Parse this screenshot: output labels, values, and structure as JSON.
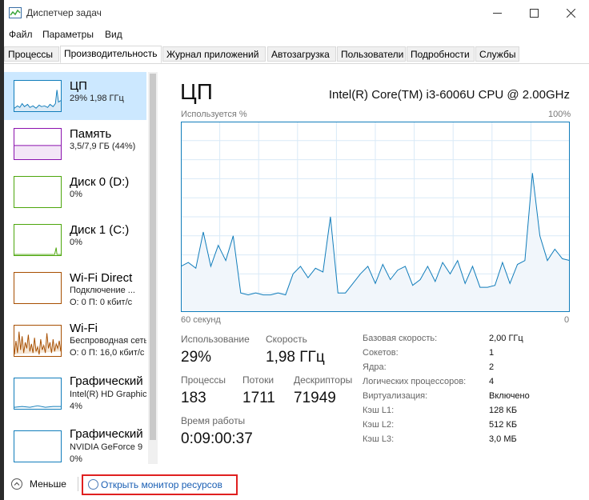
{
  "window": {
    "title": "Диспетчер задач"
  },
  "menu": [
    "Файл",
    "Параметры",
    "Вид"
  ],
  "tabs": [
    "Процессы",
    "Производительность",
    "Журнал приложений",
    "Автозагрузка",
    "Пользователи",
    "Подробности",
    "Службы"
  ],
  "active_tab": "Производительность",
  "sidebar": {
    "items": [
      {
        "name": "ЦП",
        "lines": [
          "29% 1,98 ГГц"
        ],
        "color": "#117dbb"
      },
      {
        "name": "Память",
        "lines": [
          "3,5/7,9 ГБ (44%)"
        ],
        "color": "#8b12ae"
      },
      {
        "name": "Диск 0 (D:)",
        "lines": [
          "0%"
        ],
        "color": "#4da60c"
      },
      {
        "name": "Диск 1 (C:)",
        "lines": [
          "0%"
        ],
        "color": "#4da60c"
      },
      {
        "name": "Wi-Fi Direct",
        "lines": [
          "Подключение ...",
          "О: 0 П: 0 кбит/с"
        ],
        "color": "#a74f01"
      },
      {
        "name": "Wi-Fi",
        "lines": [
          "Беспроводная сеть",
          "О: 0 П: 16,0 кбит/с"
        ],
        "color": "#a74f01"
      },
      {
        "name": "Графический",
        "lines": [
          "Intel(R) HD Graphics",
          "4%"
        ],
        "color": "#117dbb"
      },
      {
        "name": "Графический",
        "lines": [
          "NVIDIA GeForce 9",
          "0%"
        ],
        "color": "#117dbb"
      }
    ]
  },
  "main": {
    "title": "ЦП",
    "cpu_name": "Intel(R) Core(TM) i3-6006U CPU @ 2.00GHz",
    "graph": {
      "ylabel": "Используется %",
      "ymax_label": "100%",
      "xlabel": "60 секунд",
      "xmin_label": "0",
      "color": "#117dbb"
    },
    "stats": {
      "usage_label": "Использование",
      "usage_value": "29%",
      "speed_label": "Скорость",
      "speed_value": "1,98 ГГц",
      "processes_label": "Процессы",
      "processes_value": "183",
      "threads_label": "Потоки",
      "threads_value": "1711",
      "handles_label": "Дескрипторы",
      "handles_value": "71949",
      "uptime_label": "Время работы",
      "uptime_value": "0:09:00:37"
    },
    "info": [
      {
        "label": "Базовая скорость:",
        "value": "2,00 ГГц"
      },
      {
        "label": "Сокетов:",
        "value": "1"
      },
      {
        "label": "Ядра:",
        "value": "2"
      },
      {
        "label": "Логических процессоров:",
        "value": "4"
      },
      {
        "label": "Виртуализация:",
        "value": "Включено"
      },
      {
        "label": "Кэш L1:",
        "value": "128 КБ"
      },
      {
        "label": "Кэш L2:",
        "value": "512 КБ"
      },
      {
        "label": "Кэш L3:",
        "value": "3,0 МБ"
      }
    ]
  },
  "bottom": {
    "fewer_label": "Меньше",
    "resmon_label": "Открыть монитор ресурсов"
  },
  "chart_data": {
    "type": "area",
    "ylabel": "Используется %",
    "xlabel": "60 секунд",
    "xlim": [
      60,
      0
    ],
    "ylim": [
      0,
      100
    ],
    "grid": true,
    "series": [
      {
        "values": [
          24,
          26,
          23,
          42,
          24,
          35,
          27,
          40,
          10,
          9,
          10,
          9,
          9,
          10,
          9,
          20,
          24,
          18,
          23,
          21,
          50,
          10,
          10,
          15,
          20,
          24,
          15,
          25,
          17,
          22,
          24,
          14,
          17,
          24,
          16,
          26,
          20,
          27,
          15,
          24,
          13,
          13,
          14,
          26,
          15,
          25,
          27,
          73,
          40,
          27,
          33,
          28,
          27
        ]
      }
    ]
  }
}
